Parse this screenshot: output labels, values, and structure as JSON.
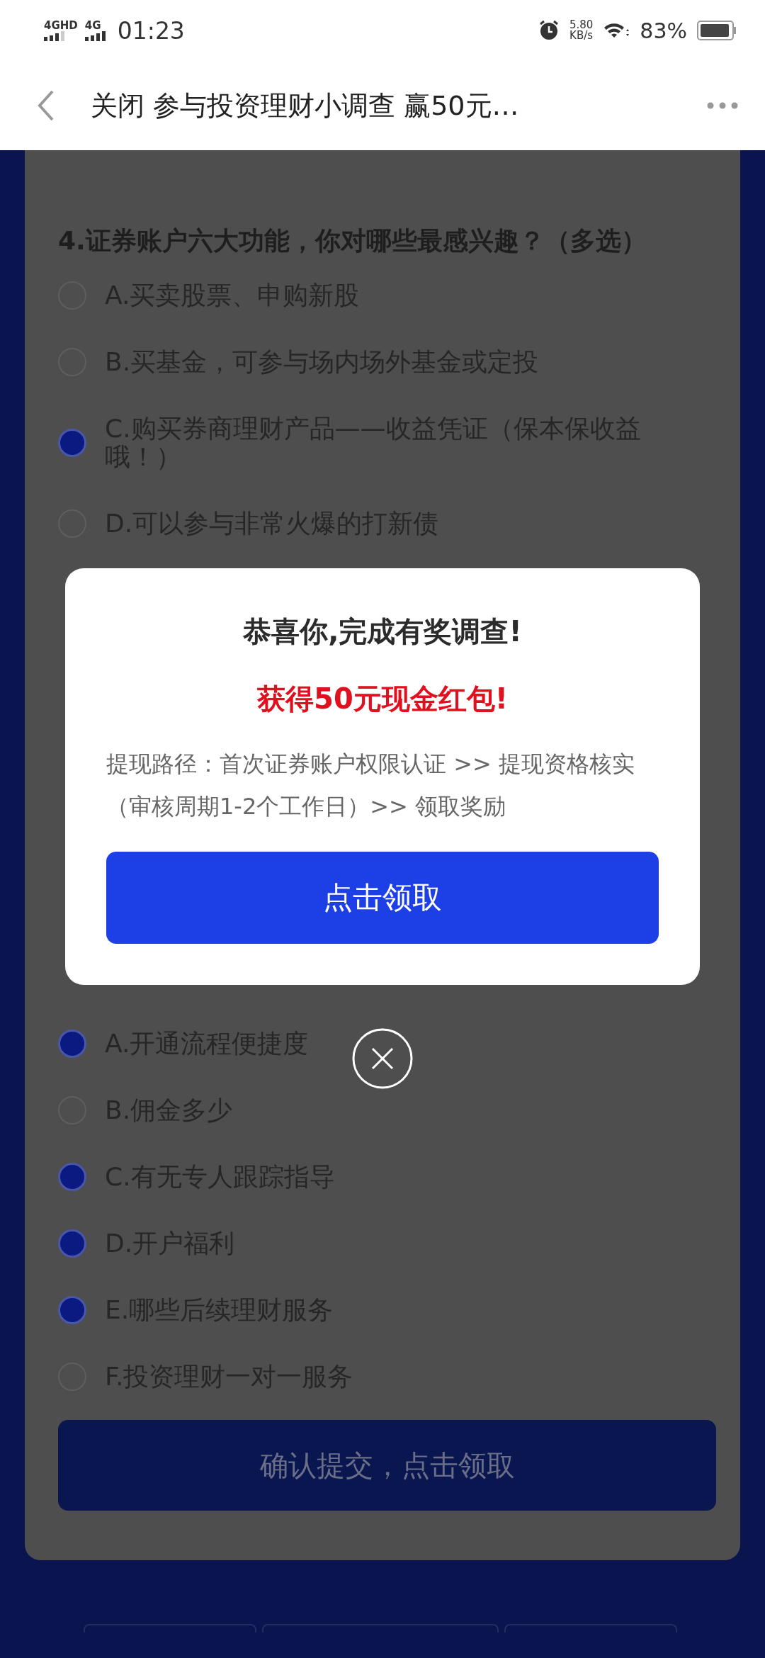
{
  "status_bar": {
    "network_1": "4GHD",
    "network_2": "4G",
    "time": "01:23",
    "speed_value": "5.80",
    "speed_unit": "KB/s",
    "battery": "83%"
  },
  "header": {
    "title": "关闭 参与投资理财小调查 赢50元…"
  },
  "survey": {
    "questions": [
      {
        "title": "4.证券账户六大功能，你对哪些最感兴趣？（多选）",
        "options": [
          {
            "label": "A.买卖股票、申购新股",
            "selected": false
          },
          {
            "label": "B.买基金，可参与场内场外基金或定投",
            "selected": false
          },
          {
            "label": "C.购买券商理财产品——收益凭证（保本保收益哦！）",
            "selected": true
          },
          {
            "label": "D.可以参与非常火爆的打新债",
            "selected": false
          }
        ]
      },
      {
        "options": [
          {
            "label": "A.开通流程便捷度",
            "selected": true
          },
          {
            "label": "B.佣金多少",
            "selected": false
          },
          {
            "label": "C.有无专人跟踪指导",
            "selected": true
          },
          {
            "label": "D.开户福利",
            "selected": true
          },
          {
            "label": "E.哪些后续理财服务",
            "selected": true
          },
          {
            "label": "F.投资理财一对一服务",
            "selected": false
          }
        ]
      }
    ],
    "submit": "确认提交，点击领取"
  },
  "dialog": {
    "title": "恭喜你,完成有奖调查!",
    "prize": "获得50元现金红包!",
    "body": "提现路径：首次证券账户权限认证 >> 提现资格核实（审核周期1-2个工作日）>> 领取奖励",
    "button": "点击领取"
  }
}
